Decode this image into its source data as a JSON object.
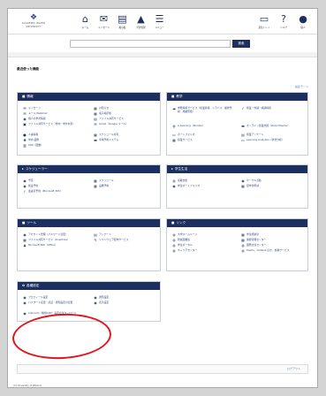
{
  "header": {
    "logo_text": "ACADEMIC WATER",
    "logo_sub": "UNIVERSITY",
    "nav": [
      {
        "icon": "home-icon",
        "label": "ホーム"
      },
      {
        "icon": "mail-icon",
        "label": "メッセージ"
      },
      {
        "icon": "board-icon",
        "label": "掲示板"
      },
      {
        "icon": "graduation-cap-icon",
        "label": "学習管理"
      },
      {
        "icon": "list-icon",
        "label": "メニュー"
      }
    ],
    "right_nav": [
      {
        "icon": "inbox-icon",
        "label": "受信トレイ"
      },
      {
        "icon": "help-icon",
        "label": "ヘルプ"
      },
      {
        "icon": "user-icon",
        "label": "個人"
      }
    ]
  },
  "search": {
    "placeholder": "",
    "button": "検索"
  },
  "page_title": "最近使った機能",
  "edit_link": "編集モード",
  "panels": [
    {
      "title": "情報",
      "items": [
        {
          "icon": "envelope-icon",
          "label": "メッセージ"
        },
        {
          "icon": "mail-icon",
          "label": "メール Webmail"
        },
        {
          "icon": "person-icon",
          "label": "個人の学習情報"
        },
        {
          "icon": "file-icon",
          "label": "ファイル共有サービス（学内・学外共有）"
        },
        {
          "icon": "user-icon",
          "label": "人事情報"
        },
        {
          "icon": "tree-icon",
          "label": "学内 業務"
        },
        {
          "icon": "book-icon",
          "label": "CRS（図書）"
        },
        {
          "icon": "grid-icon",
          "label": "お知らせ"
        },
        {
          "icon": "grid-icon",
          "label": "電子掲示板"
        },
        {
          "icon": "folder-icon",
          "label": "ファイル共有サービス"
        },
        {
          "icon": "mail-icon",
          "label": "Gmail（Google メール）"
        },
        {
          "icon": "calendar-icon",
          "label": "スケジュール共有"
        },
        {
          "icon": "car-icon",
          "label": "車両予約システム"
        }
      ]
    },
    {
      "title": "教学",
      "items": [
        {
          "icon": "cloud-icon",
          "label": "学務情報サービス（授業情報、シラバス、履修登録、成績照会）"
        },
        {
          "icon": "globe-icon",
          "label": "e-Learning（Moodle）"
        },
        {
          "icon": "id-icon",
          "label": "ポートフォリオ"
        },
        {
          "icon": "grid-icon",
          "label": "授業サービス"
        },
        {
          "icon": "check-icon",
          "label": "授業・休講・補講情報"
        },
        {
          "icon": "card-icon",
          "label": "オンライン授業支援（Zoom/Teams）"
        },
        {
          "icon": "doc-icon",
          "label": "授業アンケート"
        },
        {
          "icon": "monitor-icon",
          "label": "Learning Analytics（学習分析）"
        }
      ]
    },
    {
      "title": "スケジューラー",
      "items": [
        {
          "icon": "person-icon",
          "label": "予定"
        },
        {
          "icon": "person-icon",
          "label": "施設予約"
        },
        {
          "icon": "check-icon",
          "label": "会議室予約（Microsoft 365）"
        },
        {
          "icon": "calendar-icon",
          "label": "スケジュール"
        },
        {
          "icon": "grid-icon",
          "label": "設備予約"
        }
      ]
    },
    {
      "title": "学生生活",
      "items": [
        {
          "icon": "globe-icon",
          "label": "就職支援"
        },
        {
          "icon": "person-icon",
          "label": "学生ポートフォリオ"
        },
        {
          "icon": "person-icon",
          "label": "サークル活動"
        },
        {
          "icon": "grid-icon",
          "label": "奨学金申請"
        }
      ]
    },
    {
      "title": "ツール",
      "items": [
        {
          "icon": "person-icon",
          "label": "アカウント管理（パスワード変更）"
        },
        {
          "icon": "grid-icon",
          "label": "ファイル共有サービス（OneDrive）"
        },
        {
          "icon": "users-icon",
          "label": "Microsoft 365（Office）"
        },
        {
          "icon": "doc-icon",
          "label": "アンケート"
        },
        {
          "icon": "edit-icon",
          "label": "ソフトウェア配布サービス"
        }
      ]
    },
    {
      "title": "リンク",
      "items": [
        {
          "icon": "globe-icon",
          "label": "大学ホームページ"
        },
        {
          "icon": "globe-icon",
          "label": "附属図書館"
        },
        {
          "icon": "globe-icon",
          "label": "学生ポータル"
        },
        {
          "icon": "globe-icon",
          "label": "キャリアセンター"
        },
        {
          "icon": "grid-icon",
          "label": "学生相談室"
        },
        {
          "icon": "grid-icon",
          "label": "保健管理センター"
        },
        {
          "icon": "globe-icon",
          "label": "国際交流センター"
        },
        {
          "icon": "globe-icon",
          "label": "Teams、Outlook ほか、各種サービス"
        }
      ]
    },
    {
      "title": "各種設定",
      "items": [
        {
          "icon": "person-icon",
          "label": "プロフィール設定"
        },
        {
          "icon": "person-icon",
          "label": "パスワード変更・認証・通知設定の変更"
        },
        {
          "icon": "person-icon",
          "label": "eduroam（無線LAN）設定のダウンロード"
        },
        {
          "icon": "person-icon",
          "label": "通知設定"
        },
        {
          "icon": "person-icon",
          "label": "表示設定"
        }
      ]
    }
  ],
  "more_label": "もっと見る",
  "bottom_link": "ログアウト",
  "copyright": "(C) University of Wisdom"
}
